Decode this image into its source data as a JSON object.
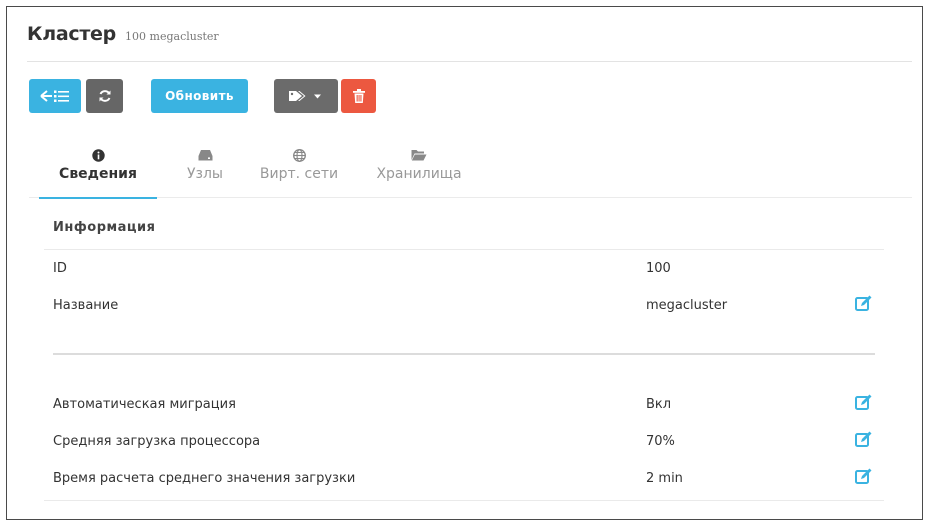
{
  "header": {
    "title": "Кластер",
    "subtitle": "100 megacluster"
  },
  "toolbar": {
    "update_label": "Обновить"
  },
  "tabs": [
    {
      "label": "Сведения",
      "icon": "info-circle-icon",
      "active": true
    },
    {
      "label": "Узлы",
      "icon": "server-icon",
      "active": false
    },
    {
      "label": "Вирт. сети",
      "icon": "globe-icon",
      "active": false
    },
    {
      "label": "Хранилища",
      "icon": "folder-open-icon",
      "active": false
    }
  ],
  "info": {
    "title": "Информация",
    "rows": [
      {
        "key": "ID",
        "value": "100"
      },
      {
        "key": "Название",
        "value": "megacluster"
      }
    ]
  },
  "attributes": {
    "rows": [
      {
        "key": "Автоматическая миграция",
        "value": "Вкл"
      },
      {
        "key": "Средняя загрузка процессора",
        "value": "70%"
      },
      {
        "key": "Время расчета среднего значения загрузки",
        "value": "2 min"
      }
    ]
  },
  "colors": {
    "accent": "#3ab3e1",
    "danger": "#ec5840",
    "neutral": "#6b6b6b"
  }
}
